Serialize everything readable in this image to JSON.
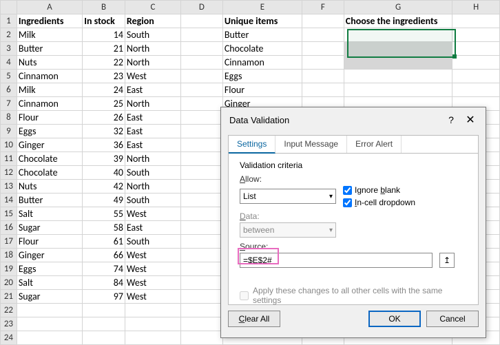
{
  "columns": [
    "A",
    "B",
    "C",
    "D",
    "E",
    "F",
    "G",
    "H"
  ],
  "rows_count": 24,
  "headers": {
    "A1": "Ingredients",
    "B1": "In stock",
    "C1": "Region",
    "E1": "Unique items",
    "G1": "Choose the ingredients"
  },
  "table": [
    {
      "ingredient": "Milk",
      "stock": 14,
      "region": "South"
    },
    {
      "ingredient": "Butter",
      "stock": 21,
      "region": "North"
    },
    {
      "ingredient": "Nuts",
      "stock": 22,
      "region": "North"
    },
    {
      "ingredient": "Cinnamon",
      "stock": 23,
      "region": "West"
    },
    {
      "ingredient": "Milk",
      "stock": 24,
      "region": "East"
    },
    {
      "ingredient": "Cinnamon",
      "stock": 25,
      "region": "North"
    },
    {
      "ingredient": "Flour",
      "stock": 26,
      "region": "East"
    },
    {
      "ingredient": "Eggs",
      "stock": 32,
      "region": "East"
    },
    {
      "ingredient": "Ginger",
      "stock": 36,
      "region": "East"
    },
    {
      "ingredient": "Chocolate",
      "stock": 39,
      "region": "North"
    },
    {
      "ingredient": "Chocolate",
      "stock": 40,
      "region": "South"
    },
    {
      "ingredient": "Nuts",
      "stock": 42,
      "region": "North"
    },
    {
      "ingredient": "Butter",
      "stock": 49,
      "region": "South"
    },
    {
      "ingredient": "Salt",
      "stock": 55,
      "region": "West"
    },
    {
      "ingredient": "Sugar",
      "stock": 58,
      "region": "East"
    },
    {
      "ingredient": "Flour",
      "stock": 61,
      "region": "South"
    },
    {
      "ingredient": "Ginger",
      "stock": 66,
      "region": "West"
    },
    {
      "ingredient": "Eggs",
      "stock": 74,
      "region": "West"
    },
    {
      "ingredient": "Salt",
      "stock": 84,
      "region": "West"
    },
    {
      "ingredient": "Sugar",
      "stock": 97,
      "region": "West"
    }
  ],
  "unique": [
    "Butter",
    "Chocolate",
    "Cinnamon",
    "Eggs",
    "Flour",
    "Ginger"
  ],
  "dialog": {
    "title": "Data Validation",
    "tabs": [
      "Settings",
      "Input Message",
      "Error Alert"
    ],
    "criteria_label": "Validation criteria",
    "allow_label": "Allow:",
    "allow_value": "List",
    "ignore_blank": "Ignore blank",
    "incell_dd": "In-cell dropdown",
    "data_label": "Data:",
    "data_value": "between",
    "source_label": "Source:",
    "source_value": "=$E$2#",
    "apply_text": "Apply these changes to all other cells with the same settings",
    "clear": "Clear All",
    "ok": "OK",
    "cancel": "Cancel"
  }
}
